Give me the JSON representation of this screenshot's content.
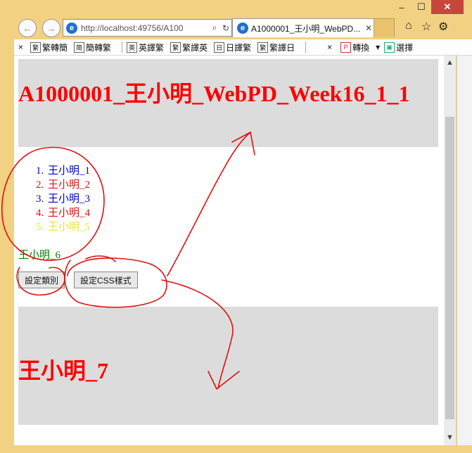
{
  "browser": {
    "window_buttons": {
      "minimize": "–",
      "restore": "☐",
      "close": "✕"
    },
    "back_glyph": "←",
    "forward_glyph": "→",
    "address_url": "http://localhost:49756/A100",
    "address_search_glyph": "⌕",
    "address_refresh_glyph": "↻",
    "tab_title": "A1000001_王小明_WebPD...",
    "tab_close": "✕",
    "home_glyph": "⌂",
    "favorites_glyph": "☆",
    "settings_glyph": "⚙"
  },
  "commandbar": {
    "close_left": "×",
    "items": [
      {
        "glyph": "繁",
        "label": "繁轉簡"
      },
      {
        "glyph": "简",
        "label": "簡轉繁"
      },
      {
        "glyph": "英",
        "label": "英譯繁"
      },
      {
        "glyph": "繁",
        "label": "繁譯英"
      },
      {
        "glyph": "日",
        "label": "日譯繁"
      },
      {
        "glyph": "繁",
        "label": "繁譯日"
      }
    ],
    "close_right": "×",
    "convert_label": "轉換",
    "convert_arrow": "▾",
    "select_label": "選擇"
  },
  "page": {
    "header_title": "A1000001_王小明_WebPD_Week16_1_1",
    "list_items": [
      {
        "text": "王小明_1",
        "color": "#0000cc"
      },
      {
        "text": "王小明_2",
        "color": "#e21010"
      },
      {
        "text": "王小明_3",
        "color": "#0000cc"
      },
      {
        "text": "王小明_4",
        "color": "#e21010"
      },
      {
        "text": "王小明_5",
        "color": "#e6e63a"
      }
    ],
    "paragraph6": "王小明_6",
    "button_set_class": "設定類別",
    "button_set_css": "設定CSS樣式",
    "footer_title": "王小明_7"
  },
  "scrollbar": {
    "up": "▲",
    "down": "▼"
  }
}
